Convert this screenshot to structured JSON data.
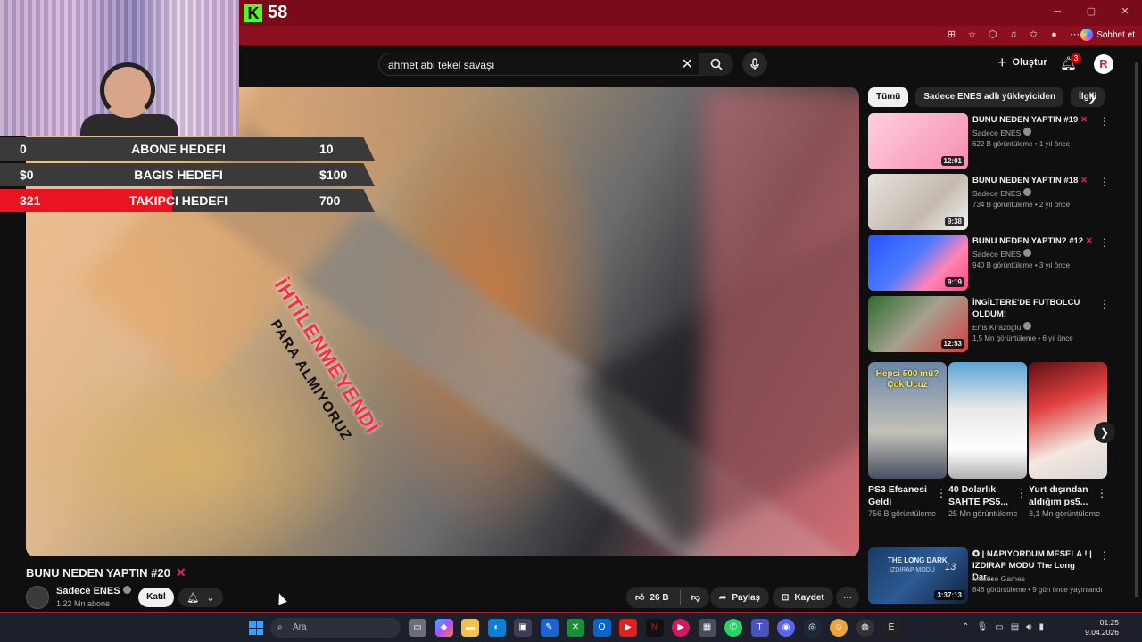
{
  "stream": {
    "viewer_count": "58",
    "goals": [
      {
        "current": "0",
        "name": "ABONE HEDEFI",
        "target": "10",
        "progress": 0.0
      },
      {
        "current": "$0",
        "name": "BAGIS HEDEFI",
        "target": "$100",
        "progress": 0.0
      },
      {
        "current": "321",
        "name": "TAKIPCI HEDEFI",
        "target": "700",
        "progress": 0.4586
      }
    ]
  },
  "browser": {
    "copilot_label": "Sohbet et"
  },
  "header": {
    "search_value": "ahmet abi tekel savaşı",
    "create_label": "Oluştur",
    "notification_count": "3",
    "account_initial": "R"
  },
  "video": {
    "overlay_red": "İHTİLENMEYENDİ",
    "overlay_dark": "PARA ALMIYORUZ",
    "title": "BUNU NEDEN YAPTIN #20",
    "title_mark": "✕",
    "channel": "Sadece ENES",
    "subscribers": "1,22 Mn abone",
    "join_label": "Katıl",
    "likes": "26 B",
    "share_label": "Paylaş",
    "save_label": "Kaydet"
  },
  "sidebar": {
    "chips": [
      "Tümü",
      "Sadece ENES adlı yükleyiciden",
      "İlgili"
    ],
    "recommendations": [
      {
        "title": "BUNU NEDEN YAPTIN #19",
        "mark": "✕",
        "channel": "Sadece ENES",
        "views": "622 B görüntüleme",
        "age": "1 yıl önce",
        "duration": "12:01"
      },
      {
        "title": "BUNU NEDEN YAPTIN #18",
        "mark": "✕",
        "channel": "Sadece ENES",
        "views": "734 B görüntüleme",
        "age": "2 yıl önce",
        "duration": "9:38"
      },
      {
        "title": "BUNU NEDEN YAPTIN? #12",
        "mark": "✕",
        "channel": "Sadece ENES",
        "views": "940 B görüntüleme",
        "age": "3 yıl önce",
        "duration": "9:19"
      },
      {
        "title": "İNGİLTERE'DE FUTBOLCU OLDUM!",
        "mark": "",
        "channel": "Enis Kirazoglu",
        "views": "1,5 Mn görüntüleme",
        "age": "6 yıl önce",
        "duration": "12:53"
      }
    ],
    "shorts": [
      {
        "title": "PS3 Efsanesi Geldi",
        "views": "756 B görüntüleme",
        "banner": "Hepsi 500 mü? Çok Ucuz"
      },
      {
        "title": "40 Dolarlık SAHTE PS5...",
        "views": "25 Mn görüntüleme",
        "banner": ""
      },
      {
        "title": "Yurt dışından aldığım ps5...",
        "views": "3,1 Mn görüntüleme",
        "banner": ""
      }
    ],
    "bottom_rec": {
      "title": "| NAPIYORDUM MESELA ! | IZDIRAP MODU The Long Dar...",
      "channel": "Mustice Games",
      "meta": "848 görüntüleme • 9 gün önce yayınlandı",
      "duration": "3:37:13",
      "thumb_text": "THE LONG DARK",
      "thumb_sub": "IZDIRAP MODU",
      "thumb_num": "13"
    }
  },
  "taskbar": {
    "search_placeholder": "Ara",
    "time": "01:25",
    "date": "9.04.2026"
  },
  "colors": {
    "stream_red": "#e8141f",
    "kick_green": "#53fc18",
    "youtube_bg": "#0f0f0f"
  }
}
